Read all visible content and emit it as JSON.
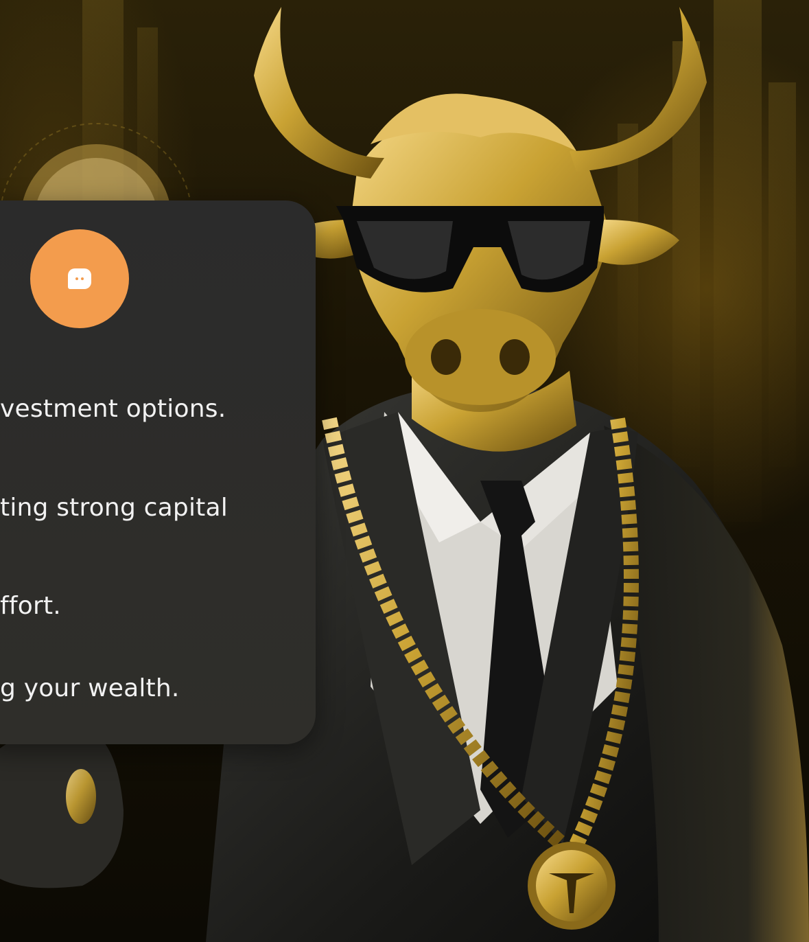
{
  "card": {
    "icon": "chat-bubble-icon",
    "lines": [
      "vestment options.",
      "ting strong capital",
      "ffort.",
      "g your wealth."
    ]
  },
  "colors": {
    "card_bg": "#2b2b2b",
    "accent": "#f39c4d",
    "text": "#f2f2f2",
    "gold": "#c9a233"
  }
}
